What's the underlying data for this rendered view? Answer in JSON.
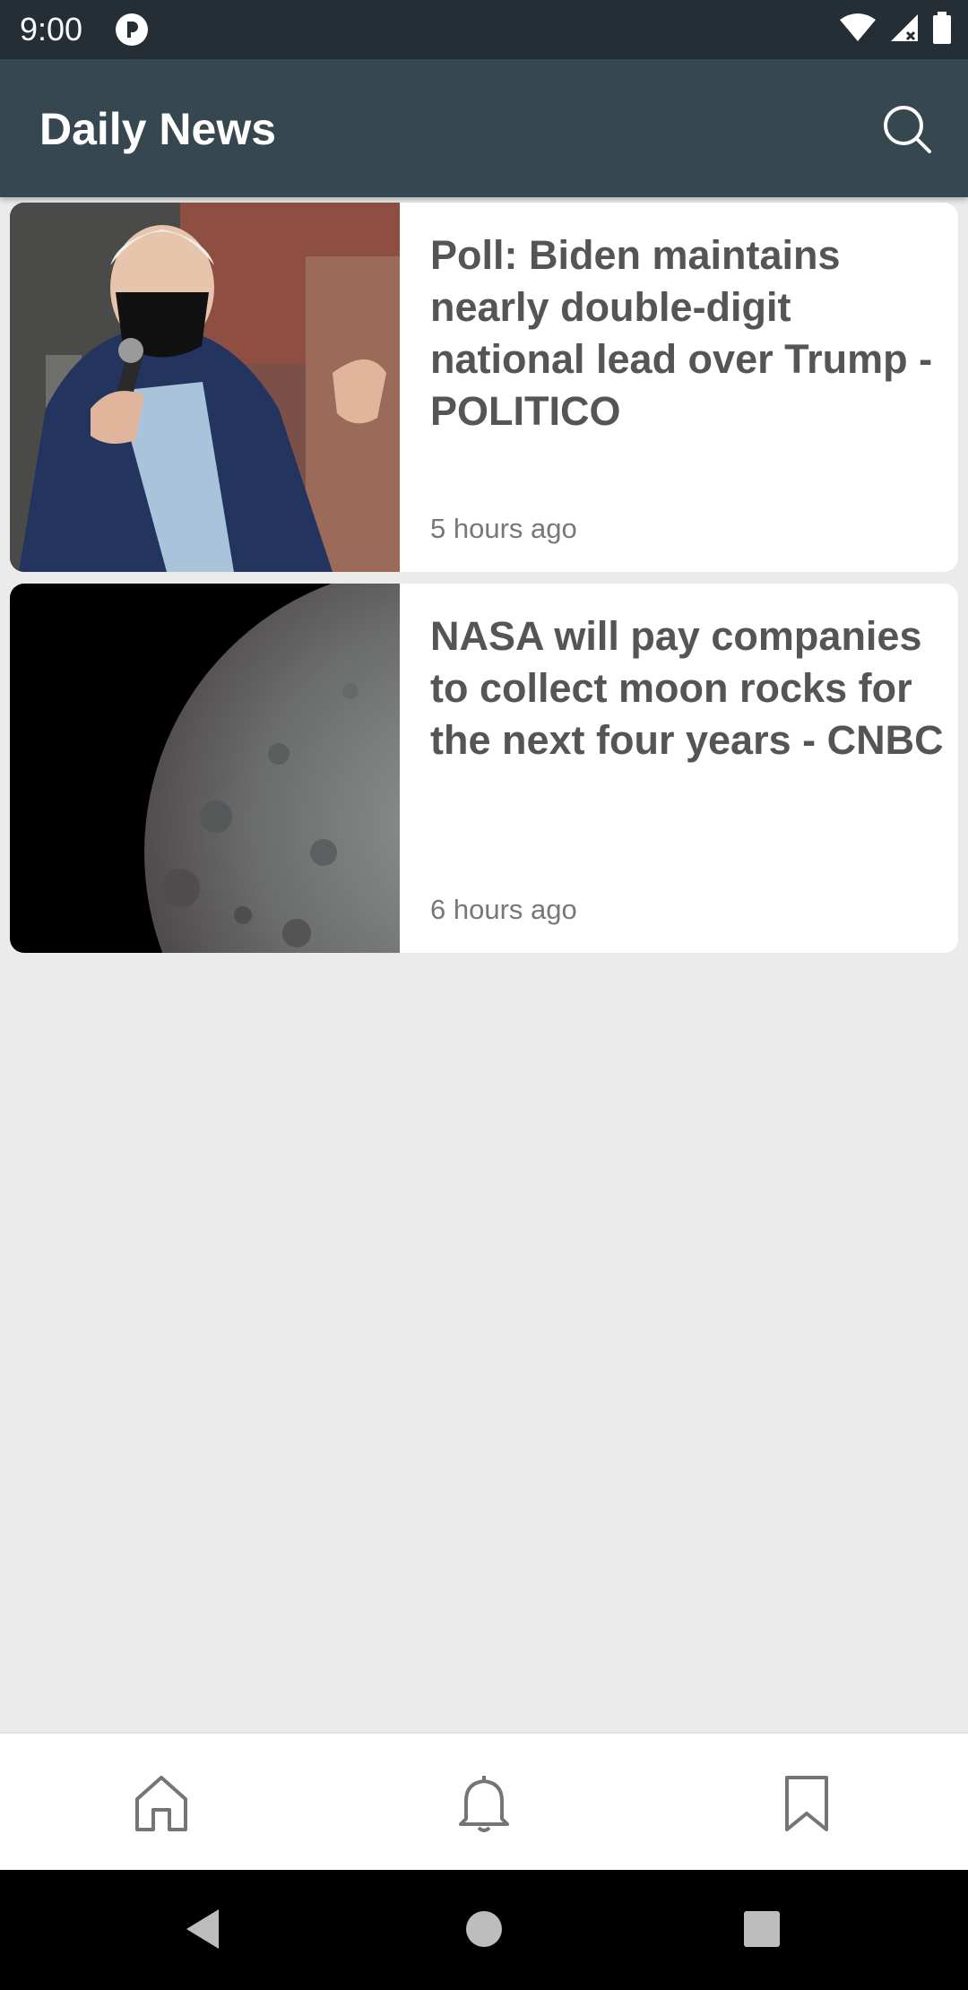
{
  "status_bar": {
    "time": "9:00",
    "icons": [
      "app-notification-icon",
      "wifi-icon",
      "signal-icon",
      "battery-icon"
    ]
  },
  "app_bar": {
    "title": "Daily News",
    "search_icon": "search-icon"
  },
  "articles": [
    {
      "headline": "Poll: Biden maintains nearly double-digit national lead over Trump - POLITICO",
      "time": "5 hours ago",
      "image": "photo of man in mask with microphone"
    },
    {
      "headline": "NASA will pay companies to collect moon rocks for the next four years - CNBC",
      "time": "6 hours ago",
      "image": "photo of the moon"
    }
  ],
  "bottom_nav": {
    "items": [
      "home-icon",
      "bell-icon",
      "bookmark-icon"
    ]
  },
  "system_nav": {
    "items": [
      "back-icon",
      "home-circle-icon",
      "recents-icon"
    ]
  },
  "colors": {
    "status_bar": "#252e34",
    "app_bar": "#37474f",
    "background": "#ebebeb",
    "headline": "#555555",
    "timestamp": "#777777"
  }
}
